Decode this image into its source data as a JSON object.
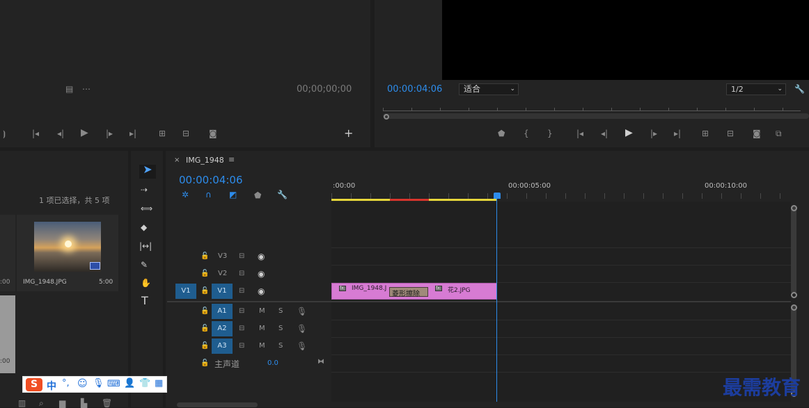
{
  "source_monitor": {
    "timecode": "00;00;00;00"
  },
  "program_monitor": {
    "timecode": "00:00:04:06",
    "fit_label": "适合",
    "resolution_label": "1/2"
  },
  "project_panel": {
    "selection_status": "1 项已选择，共 5 项",
    "clip_name": "IMG_1948.JPG",
    "clip_duration": "5:00",
    "left_duration_1": ":00",
    "left_duration_2": ":00"
  },
  "timeline": {
    "sequence_name": "IMG_1948",
    "timecode": "00:00:04:06",
    "ruler_labels": [
      ":00:00",
      "00:00:05:00",
      "00:00:10:00"
    ],
    "video_tracks": [
      {
        "label": "V3",
        "source": ""
      },
      {
        "label": "V2",
        "source": ""
      },
      {
        "label": "V1",
        "source": "V1"
      }
    ],
    "audio_tracks": [
      {
        "label": "A1",
        "m": "M",
        "s": "S"
      },
      {
        "label": "A2",
        "m": "M",
        "s": "S"
      },
      {
        "label": "A3",
        "m": "M",
        "s": "S"
      }
    ],
    "master": {
      "label": "主声道",
      "value": "0.0"
    },
    "clips": [
      {
        "name": "IMG_1948.J"
      },
      {
        "name": "花2.JPG"
      }
    ],
    "transition_label": "菱形擦除"
  },
  "ime_bar": {
    "mode": "中"
  },
  "watermark": "最需教育",
  "colors": {
    "accent": "#2d8ceb",
    "clip": "#d77bd3",
    "track_btn": "#1f5d8f"
  }
}
